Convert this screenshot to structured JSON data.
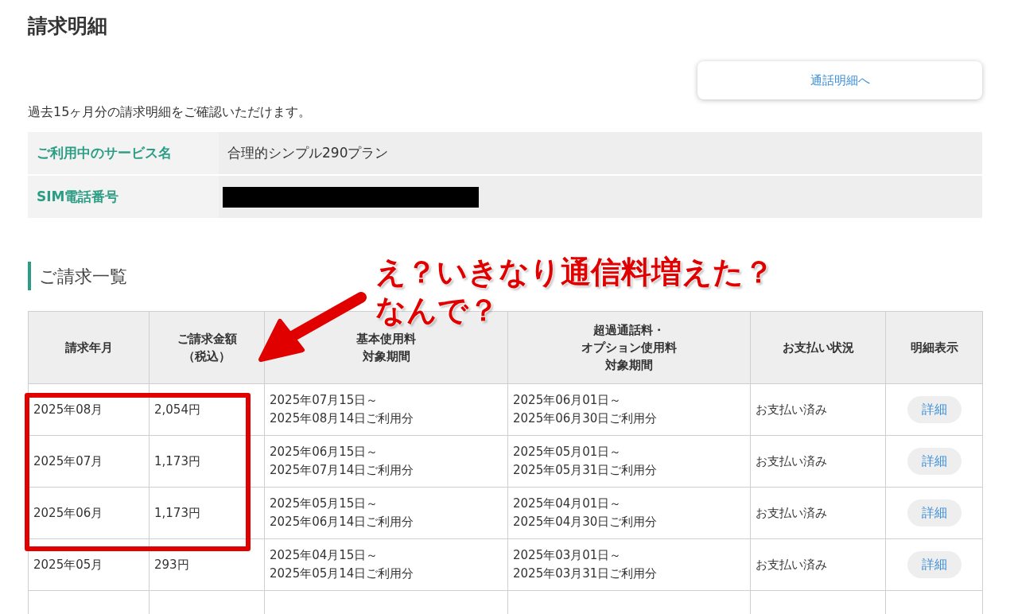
{
  "title": "請求明細",
  "call_details_button": "通話明細へ",
  "description": "過去15ヶ月分の請求明細をご確認いただけます。",
  "info": [
    {
      "label": "ご利用中のサービス名",
      "value": "合理的シンプル290プラン",
      "redacted": false
    },
    {
      "label": "SIM電話番号",
      "redacted": true
    }
  ],
  "section_title": "ご請求一覧",
  "table": {
    "columns": [
      [
        "請求年月"
      ],
      [
        "ご請求金額",
        "（税込）"
      ],
      [
        "基本使用料",
        "対象期間"
      ],
      [
        "超過通話料・",
        "オプション使用料",
        "対象期間"
      ],
      [
        "お支払い状況"
      ],
      [
        "明細表示"
      ]
    ],
    "rows": [
      {
        "month": "2025年08月",
        "amount": "2,054円",
        "basic_period": [
          "2025年07月15日～",
          "2025年08月14日ご利用分"
        ],
        "extra_period": [
          "2025年06月01日～",
          "2025年06月30日ご利用分"
        ],
        "status": "お支払い済み",
        "action": "詳細",
        "highlighted": true
      },
      {
        "month": "2025年07月",
        "amount": "1,173円",
        "basic_period": [
          "2025年06月15日～",
          "2025年07月14日ご利用分"
        ],
        "extra_period": [
          "2025年05月01日～",
          "2025年05月31日ご利用分"
        ],
        "status": "お支払い済み",
        "action": "詳細",
        "highlighted": true
      },
      {
        "month": "2025年06月",
        "amount": "1,173円",
        "basic_period": [
          "2025年05月15日～",
          "2025年06月14日ご利用分"
        ],
        "extra_period": [
          "2025年04月01日～",
          "2025年04月30日ご利用分"
        ],
        "status": "お支払い済み",
        "action": "詳細",
        "highlighted": true
      },
      {
        "month": "2025年05月",
        "amount": "293円",
        "basic_period": [
          "2025年04月15日～",
          "2025年05月14日ご利用分"
        ],
        "extra_period": [
          "2025年03月01日～",
          "2025年03月31日ご利用分"
        ],
        "status": "お支払い済み",
        "action": "詳細",
        "highlighted": false
      }
    ]
  },
  "annotation": {
    "lines": [
      "え？いきなり通信料増えた？",
      "なんで？"
    ]
  }
}
